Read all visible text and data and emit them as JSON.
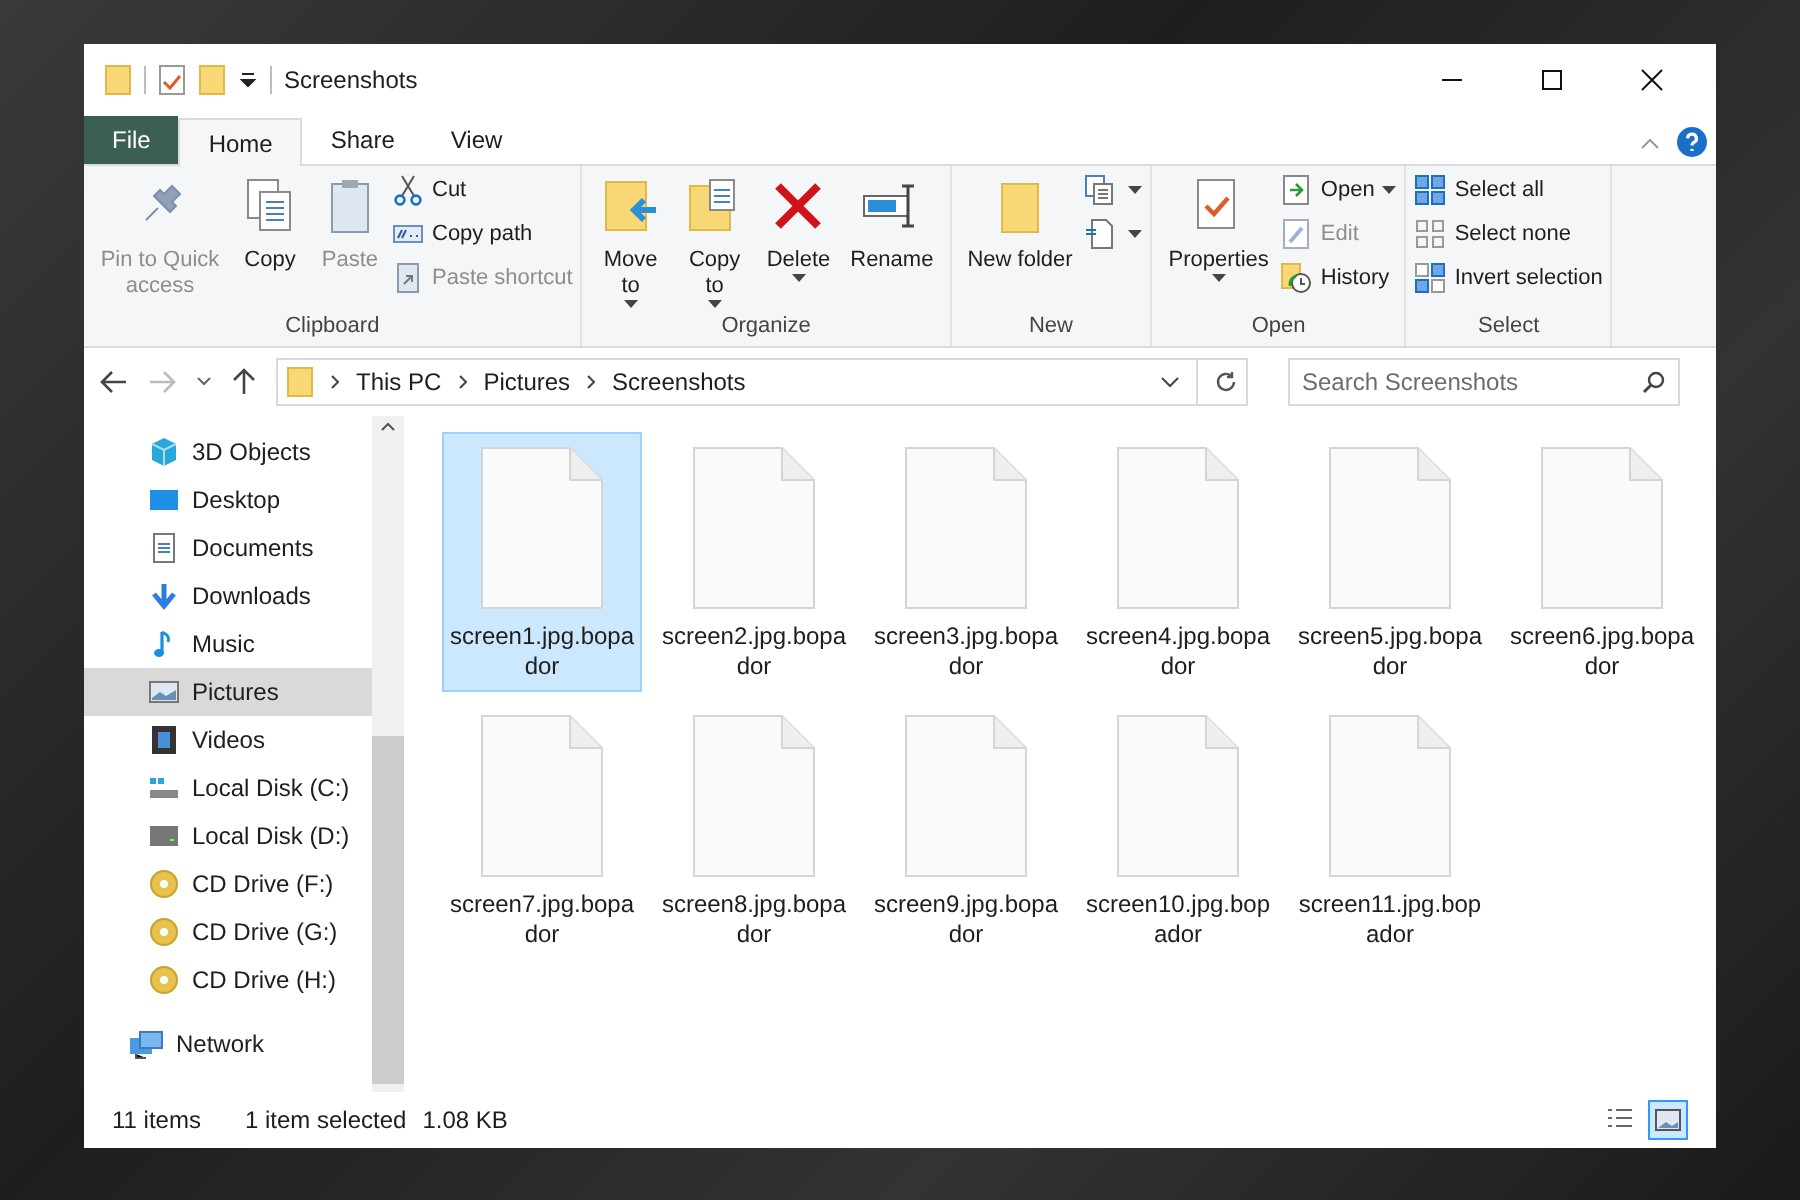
{
  "window": {
    "title": "Screenshots"
  },
  "tabs": [
    {
      "label": "File",
      "kind": "file",
      "selected": false
    },
    {
      "label": "Home",
      "kind": "tab",
      "selected": true
    },
    {
      "label": "Share",
      "kind": "tab",
      "selected": false
    },
    {
      "label": "View",
      "kind": "tab",
      "selected": false
    }
  ],
  "ribbon": {
    "groups": [
      {
        "label": "Clipboard",
        "items": [
          {
            "kind": "large",
            "label": "Pin to Quick access",
            "disabled": true,
            "dropdown": false
          },
          {
            "kind": "large",
            "label": "Copy",
            "disabled": false,
            "dropdown": false
          },
          {
            "kind": "large",
            "label": "Paste",
            "disabled": true,
            "dropdown": false
          },
          {
            "kind": "small",
            "label": "Cut",
            "disabled": false,
            "dropdown": false
          },
          {
            "kind": "small",
            "label": "Copy path",
            "disabled": false,
            "dropdown": false
          },
          {
            "kind": "small",
            "label": "Paste shortcut",
            "disabled": true,
            "dropdown": false
          }
        ]
      },
      {
        "label": "Organize",
        "items": [
          {
            "kind": "large",
            "label": "Move to",
            "disabled": false,
            "dropdown": true
          },
          {
            "kind": "large",
            "label": "Copy to",
            "disabled": false,
            "dropdown": true
          },
          {
            "kind": "large",
            "label": "Delete",
            "disabled": false,
            "dropdown": true
          },
          {
            "kind": "large",
            "label": "Rename",
            "disabled": false,
            "dropdown": false
          }
        ]
      },
      {
        "label": "New",
        "items": [
          {
            "kind": "large",
            "label": "New folder",
            "disabled": false,
            "dropdown": false
          },
          {
            "kind": "icon",
            "disabled": false,
            "dropdown": true
          },
          {
            "kind": "icon",
            "disabled": false,
            "dropdown": true
          }
        ]
      },
      {
        "label": "Open",
        "items": [
          {
            "kind": "large",
            "label": "Properties",
            "disabled": false,
            "dropdown": true
          },
          {
            "kind": "small",
            "label": "Open",
            "disabled": false,
            "dropdown": true
          },
          {
            "kind": "small",
            "label": "Edit",
            "disabled": true,
            "dropdown": false
          },
          {
            "kind": "small",
            "label": "History",
            "disabled": false,
            "dropdown": false
          }
        ]
      },
      {
        "label": "Select",
        "items": [
          {
            "kind": "small",
            "label": "Select all",
            "disabled": false,
            "dropdown": false
          },
          {
            "kind": "small",
            "label": "Select none",
            "disabled": false,
            "dropdown": false
          },
          {
            "kind": "small",
            "label": "Invert selection",
            "disabled": false,
            "dropdown": false
          }
        ]
      }
    ]
  },
  "address_bar": {
    "breadcrumbs": [
      "This PC",
      "Pictures",
      "Screenshots"
    ],
    "search": {
      "placeholder": "Search Screenshots"
    }
  },
  "navigation_pane": {
    "items": [
      {
        "label": "3D Objects",
        "selected": false
      },
      {
        "label": "Desktop",
        "selected": false
      },
      {
        "label": "Documents",
        "selected": false
      },
      {
        "label": "Downloads",
        "selected": false
      },
      {
        "label": "Music",
        "selected": false
      },
      {
        "label": "Pictures",
        "selected": true
      },
      {
        "label": "Videos",
        "selected": false
      },
      {
        "label": "Local Disk (C:)",
        "selected": false
      },
      {
        "label": "Local Disk (D:)",
        "selected": false
      },
      {
        "label": "CD Drive (F:)",
        "selected": false
      },
      {
        "label": "CD Drive (G:)",
        "selected": false
      },
      {
        "label": "CD Drive (H:)",
        "selected": false
      }
    ],
    "network": {
      "label": "Network"
    }
  },
  "files": [
    {
      "name": "screen1.jpg.bopador",
      "selected": true
    },
    {
      "name": "screen2.jpg.bopador",
      "selected": false
    },
    {
      "name": "screen3.jpg.bopador",
      "selected": false
    },
    {
      "name": "screen4.jpg.bopador",
      "selected": false
    },
    {
      "name": "screen5.jpg.bopador",
      "selected": false
    },
    {
      "name": "screen6.jpg.bopador",
      "selected": false
    },
    {
      "name": "screen7.jpg.bopador",
      "selected": false
    },
    {
      "name": "screen8.jpg.bopador",
      "selected": false
    },
    {
      "name": "screen9.jpg.bopador",
      "selected": false
    },
    {
      "name": "screen10.jpg.bopador",
      "selected": false
    },
    {
      "name": "screen11.jpg.bopador",
      "selected": false
    }
  ],
  "status_bar": {
    "item_count": "11 items",
    "selection": "1 item selected",
    "size": "1.08 KB",
    "views": [
      {
        "kind": "details",
        "selected": false
      },
      {
        "kind": "large_icons",
        "selected": true
      }
    ]
  }
}
